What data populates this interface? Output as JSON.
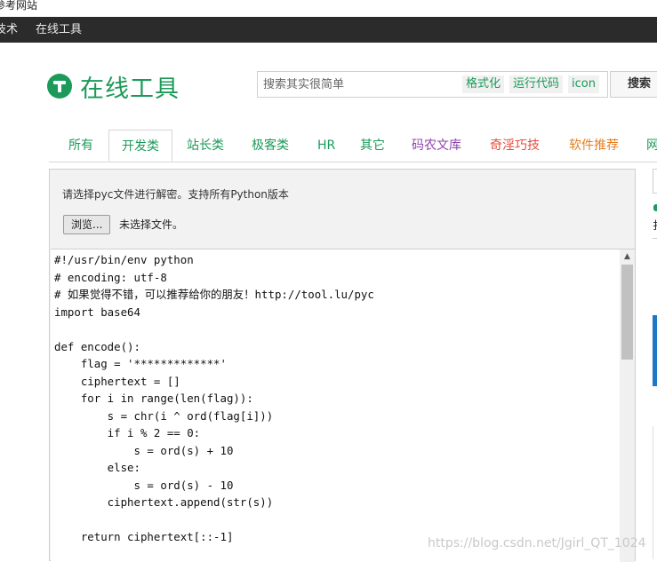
{
  "browser": {
    "page_title": "参考网站"
  },
  "navbar": {
    "items": [
      "技术",
      "在线工具"
    ]
  },
  "logo": {
    "text": "在线工具"
  },
  "search": {
    "placeholder": "搜索其实很简单",
    "chips": [
      "格式化",
      "运行代码",
      "icon"
    ],
    "button_label": "搜索"
  },
  "tabs": [
    {
      "label": "所有",
      "color": "#1b9a59"
    },
    {
      "label": "开发类",
      "color": "#1b9a59",
      "active": true
    },
    {
      "label": "站长类",
      "color": "#1b9a59"
    },
    {
      "label": "极客类",
      "color": "#1b9a59"
    },
    {
      "label": "HR",
      "color": "#1b9a59"
    },
    {
      "label": "其它",
      "color": "#1b9a59"
    },
    {
      "label": "码农文库",
      "color": "#8e44ad"
    },
    {
      "label": "奇淫巧技",
      "color": "#e74c3c"
    },
    {
      "label": "软件推荐",
      "color": "#e67e22"
    },
    {
      "label": "网",
      "color": "#1b9a59"
    }
  ],
  "tool": {
    "description": "请选择pyc文件进行解密。支持所有Python版本",
    "browse_label": "浏览...",
    "file_status": "未选择文件。"
  },
  "code_lines": [
    "#!/usr/bin/env python",
    "# encoding: utf-8",
    "# 如果觉得不错，可以推荐给你的朋友！http://tool.lu/pyc",
    "import base64",
    "",
    "def encode():",
    "    flag = '*************'",
    "    ciphertext = []",
    "    for i in range(len(flag)):",
    "        s = chr(i ^ ord(flag[i]))",
    "        if i % 2 == 0:",
    "            s = ord(s) + 10",
    "        else:",
    "            s = ord(s) - 10",
    "        ciphertext.append(str(s))",
    "",
    "    return ciphertext[::-1]"
  ],
  "right_partial_glyph": "扌",
  "watermark": "https://blog.csdn.net/Jgirl_QT_1024",
  "colors": {
    "brand": "#1b9a59",
    "navbar": "#2b2b2b"
  }
}
